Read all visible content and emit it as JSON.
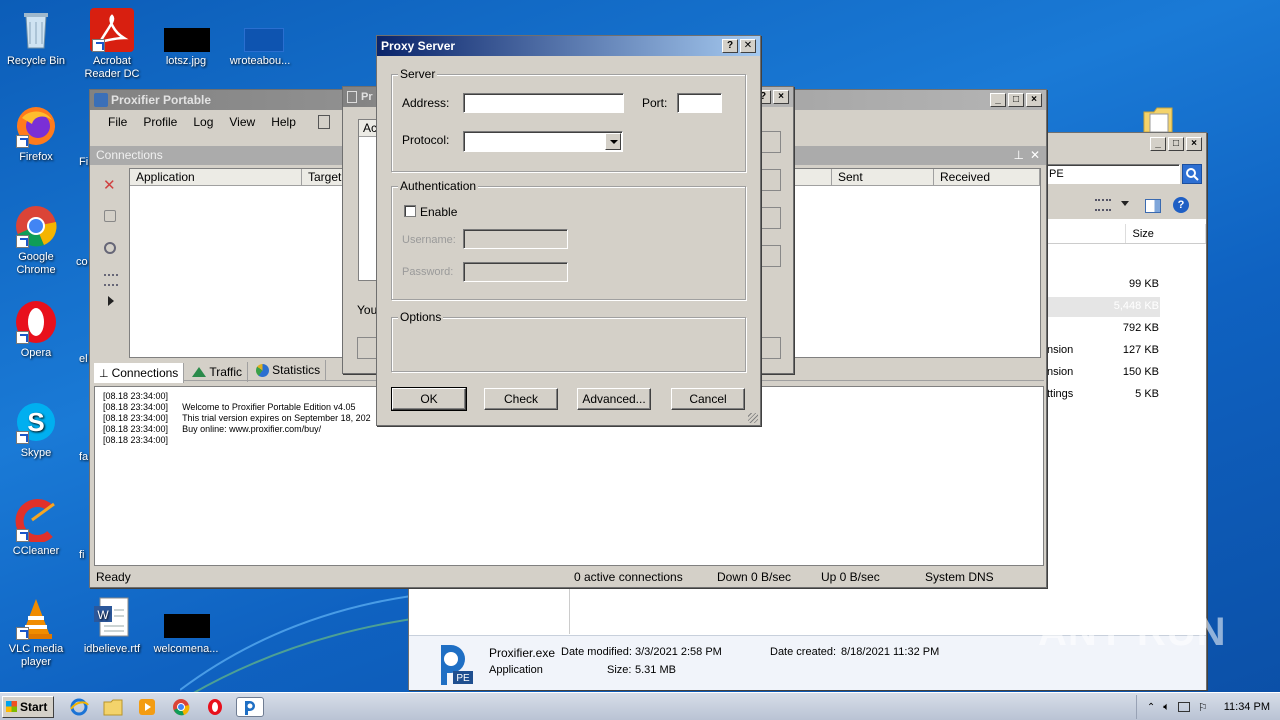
{
  "desktop": {
    "icons": [
      {
        "label": "Recycle Bin",
        "icon": "recycle-bin-icon"
      },
      {
        "label": "Acrobat Reader DC",
        "icon": "acrobat-icon"
      },
      {
        "label": "lotsz.jpg",
        "icon": "image-file-icon"
      },
      {
        "label": "wroteabou...",
        "icon": "file-icon"
      },
      {
        "label": "Firefox",
        "icon": "firefox-icon"
      },
      {
        "label": "Google Chrome",
        "icon": "chrome-icon"
      },
      {
        "label": "Opera",
        "icon": "opera-icon"
      },
      {
        "label": "Skype",
        "icon": "skype-icon"
      },
      {
        "label": "CCleaner",
        "icon": "ccleaner-icon"
      },
      {
        "label": "VLC media player",
        "icon": "vlc-icon"
      },
      {
        "label": "idbelieve.rtf",
        "icon": "word-doc-icon"
      },
      {
        "label": "welcomena...",
        "icon": "file-icon"
      },
      {
        "label": "Fi",
        "icon": "file-icon"
      },
      {
        "label": "co",
        "icon": "file-icon"
      },
      {
        "label": "el",
        "icon": "file-icon"
      },
      {
        "label": "fa",
        "icon": "file-icon"
      },
      {
        "label": "fi",
        "icon": "file-icon"
      }
    ]
  },
  "proxifier": {
    "title": "Proxifier Portable",
    "menu": [
      "File",
      "Profile",
      "Log",
      "View",
      "Help"
    ],
    "connections_panel": "Connections",
    "columns": [
      "Application",
      "Target",
      "Sent",
      "Received"
    ],
    "tabs": [
      "Connections",
      "Traffic",
      "Statistics"
    ],
    "log": {
      "timestamps": [
        "[08.18 23:34:00]",
        "[08.18 23:34:00]",
        "[08.18 23:34:00]",
        "[08.18 23:34:00]",
        "[08.18 23:34:00]"
      ],
      "messages": [
        "",
        "Welcome to Proxifier Portable Edition v4.05",
        "This trial version expires on September 18, 202",
        "Buy online: www.proxifier.com/buy/",
        ""
      ]
    },
    "status": {
      "ready": "Ready",
      "connections": "0 active connections",
      "down": "Down 0 B/sec",
      "up": "Up 0 B/sec",
      "dns": "System DNS"
    }
  },
  "behind_dialog": {
    "title": "Pr",
    "col": "Ac",
    "text": "You"
  },
  "proxy_dialog": {
    "title": "Proxy Server",
    "help_btn": "?",
    "close_btn": "✕",
    "server_group": "Server",
    "address_label": "Address:",
    "address_value": "",
    "port_label": "Port:",
    "port_value": "",
    "protocol_label": "Protocol:",
    "protocol_value": "",
    "auth_group": "Authentication",
    "enable_label": "Enable",
    "username_label": "Username:",
    "password_label": "Password:",
    "options_group": "Options",
    "ok": "OK",
    "check": "Check",
    "advanced": "Advanced...",
    "cancel": "Cancel"
  },
  "explorer": {
    "search_text": "PE",
    "size_header": "Size",
    "rows": [
      {
        "name": "",
        "size": "99 KB"
      },
      {
        "name": "",
        "size": "5,448 KB"
      },
      {
        "name": "",
        "size": "792 KB"
      },
      {
        "name": "nsion",
        "size": "127 KB"
      },
      {
        "name": "nsion",
        "size": "150 KB"
      },
      {
        "name": "ttings",
        "size": "5 KB"
      }
    ],
    "details": {
      "name": "Proxifier.exe",
      "type": "Application",
      "modified_label": "Date modified:",
      "modified": "3/3/2021 2:58 PM",
      "size_label": "Size:",
      "size": "5.31 MB",
      "created_label": "Date created:",
      "created": "8/18/2021 11:32 PM"
    }
  },
  "taskbar": {
    "start": "Start",
    "clock": "11:34 PM"
  },
  "watermark": "ANY RUN"
}
